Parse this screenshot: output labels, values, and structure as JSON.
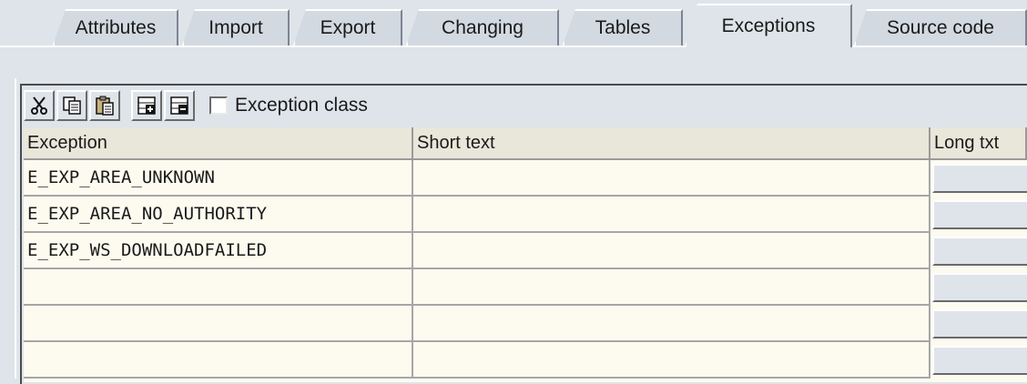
{
  "tabs": [
    {
      "label": "Attributes",
      "active": false
    },
    {
      "label": "Import",
      "active": false
    },
    {
      "label": "Export",
      "active": false
    },
    {
      "label": "Changing",
      "active": false
    },
    {
      "label": "Tables",
      "active": false
    },
    {
      "label": "Exceptions",
      "active": true
    },
    {
      "label": "Source code",
      "active": false
    }
  ],
  "toolbar": {
    "buttons": [
      "cut-icon",
      "copy-icon",
      "paste-icon",
      "insert-row-icon",
      "delete-row-icon"
    ],
    "exception_class_label": "Exception class",
    "exception_class_checked": false
  },
  "grid": {
    "columns": [
      "Exception",
      "Short text",
      "Long txt"
    ],
    "rows": [
      {
        "exception": "E_EXP_AREA_UNKNOWN",
        "short_text": ""
      },
      {
        "exception": "E_EXP_AREA_NO_AUTHORITY",
        "short_text": ""
      },
      {
        "exception": "E_EXP_WS_DOWNLOADFAILED",
        "short_text": ""
      },
      {
        "exception": "",
        "short_text": ""
      },
      {
        "exception": "",
        "short_text": ""
      },
      {
        "exception": "",
        "short_text": ""
      }
    ]
  },
  "colors": {
    "background": "#dfe4ea",
    "grid_background": "#fdfbf0",
    "header_background": "#e9e6da"
  }
}
